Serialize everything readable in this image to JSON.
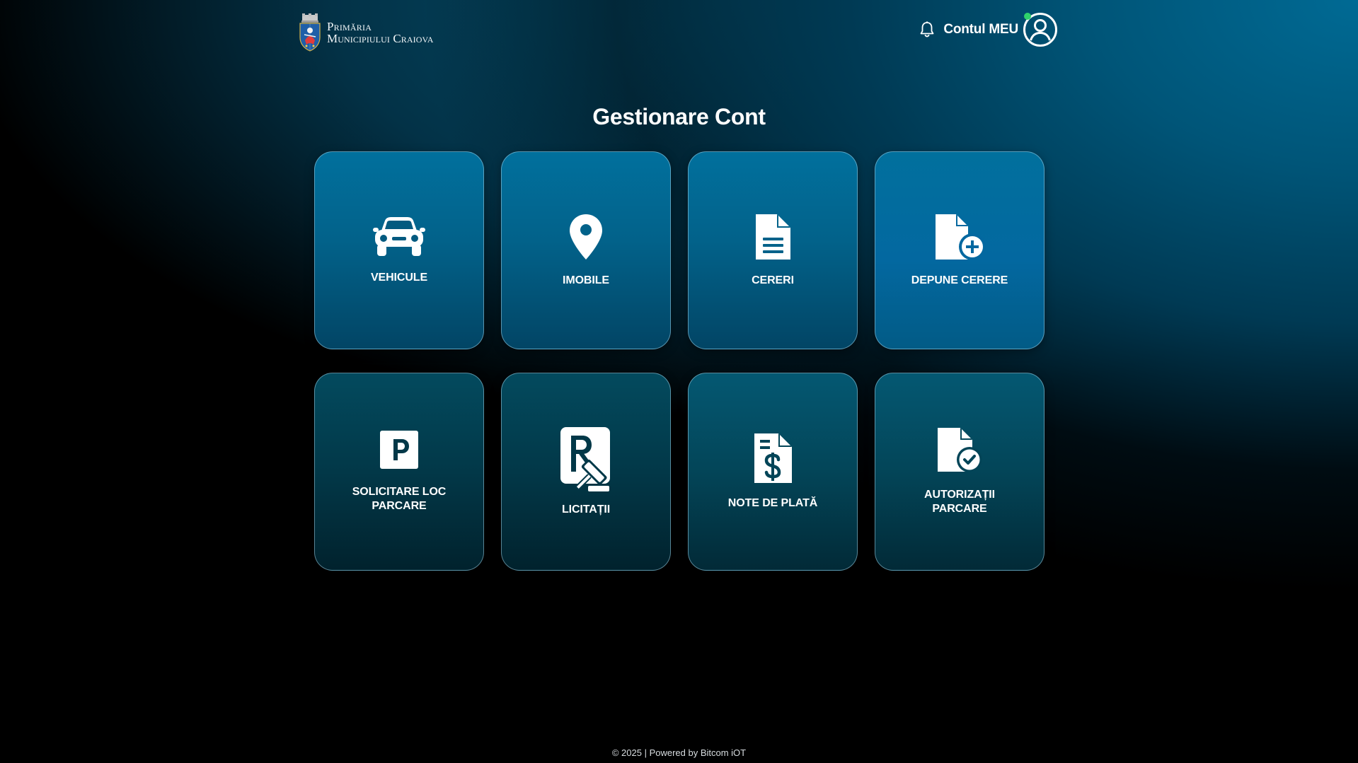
{
  "header": {
    "logo": {
      "line1": "Primăria",
      "line2": "Municipiului Craiova"
    },
    "account_label": "Contul MEU",
    "icons": {
      "bell": "bell-icon",
      "avatar": "user-circle-icon"
    },
    "status_color": "#2fd36b"
  },
  "main": {
    "title": "Gestionare Cont",
    "cards": [
      {
        "label": "VEHICULE",
        "icon": "car-icon"
      },
      {
        "label": "IMOBILE",
        "icon": "map-pin-icon"
      },
      {
        "label": "CERERI",
        "icon": "document-icon"
      },
      {
        "label": "DEPUNE CERERE",
        "icon": "document-add-icon"
      },
      {
        "label": "SOLICITARE LOC PARCARE",
        "icon": "parking-icon"
      },
      {
        "label": "LICITAȚII",
        "icon": "auction-gavel-icon"
      },
      {
        "label": "NOTE DE PLATĂ",
        "icon": "invoice-dollar-icon"
      },
      {
        "label": "AUTORIZAȚII PARCARE",
        "icon": "document-check-icon"
      }
    ]
  },
  "footer": {
    "text": "© 2025 | Powered by Bitcom iOT"
  },
  "colors": {
    "accent": "#01709d",
    "card_dark": "#023848"
  }
}
